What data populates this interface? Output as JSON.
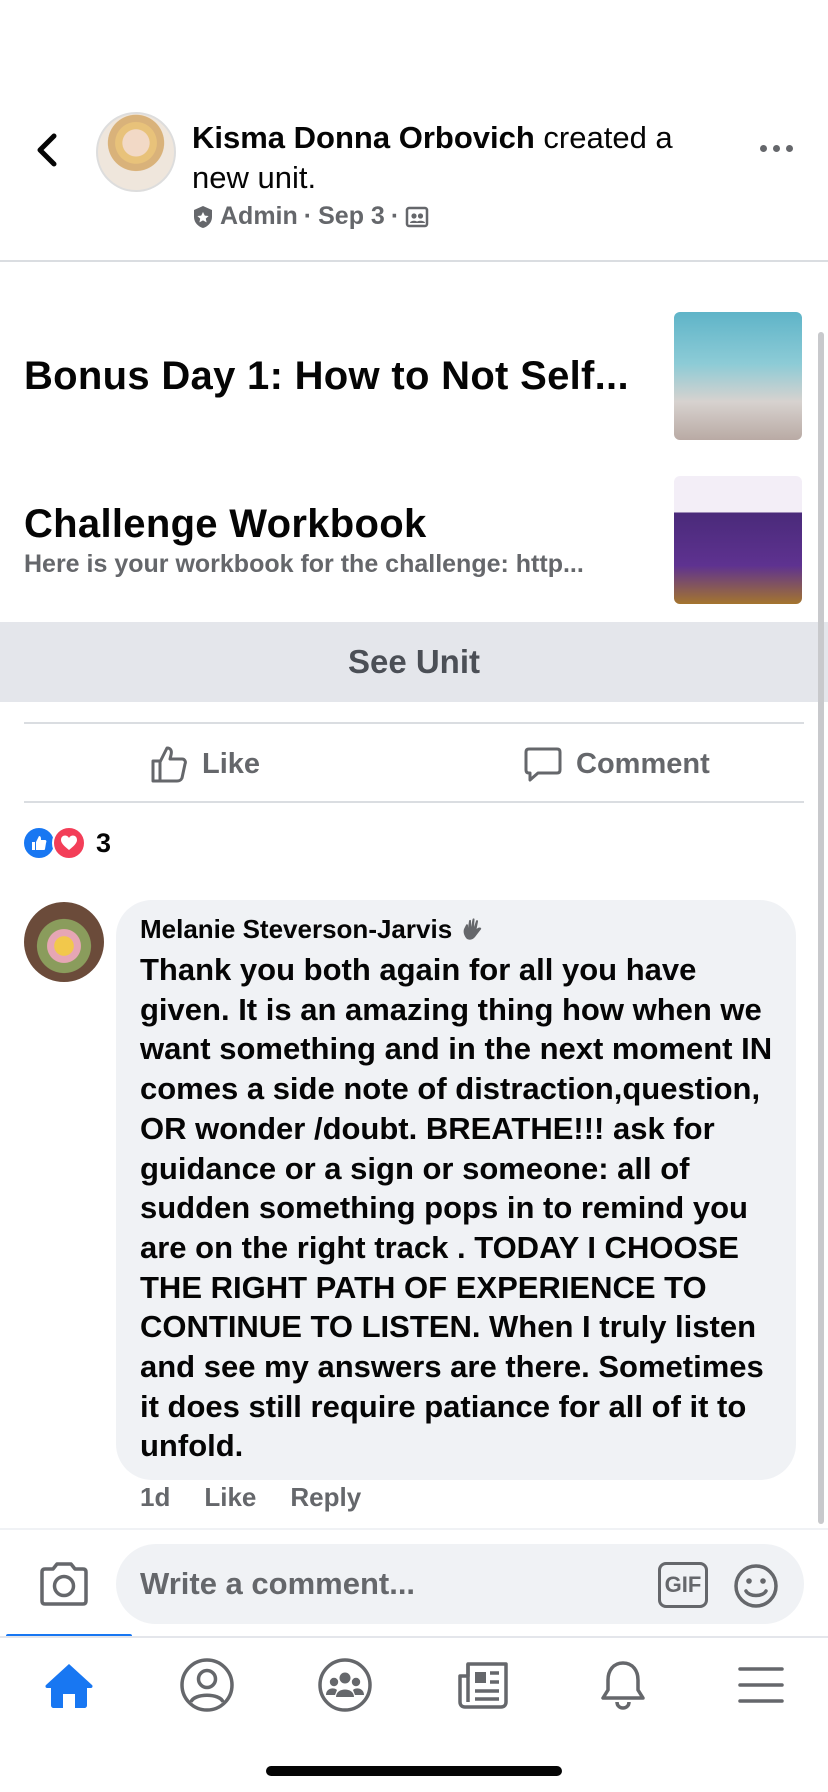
{
  "post": {
    "author": "Kisma Donna Orbovich",
    "action_text": "created a new unit.",
    "role": "Admin",
    "date": "Sep 3",
    "separator": "·"
  },
  "units": [
    {
      "title": "Bonus Day 1: How to Not Self...",
      "subtitle": ""
    },
    {
      "title": "Challenge Workbook",
      "subtitle": "Here is your workbook for the challenge: http..."
    }
  ],
  "see_unit_label": "See Unit",
  "actions": {
    "like_label": "Like",
    "comment_label": "Comment"
  },
  "reactions": {
    "count": "3"
  },
  "comment": {
    "author": "Melanie Steverson-Jarvis",
    "text": "Thank you both again for all you have given. It is an amazing thing how when we want something and in the next moment IN comes  a side note of distraction,question, OR  wonder /doubt. BREATHE!!! ask for guidance or a sign or someone:  all of sudden something pops in to remind you are on the right track . TODAY I CHOOSE THE RIGHT PATH  OF EXPERIENCE TO CONTINUE TO LISTEN. When I truly listen and see my answers are there. Sometimes it does still require patiance for all of it to unfold.",
    "age": "1d",
    "like_label": "Like",
    "reply_label": "Reply"
  },
  "composer": {
    "placeholder": "Write a comment...",
    "gif_label": "GIF"
  },
  "tabs": [
    "home-icon",
    "profile-icon",
    "groups-icon",
    "news-icon",
    "notifications-icon",
    "menu-icon"
  ],
  "colors": {
    "accent": "#1877f2",
    "love": "#f33e58",
    "muted": "#65676b",
    "bubble": "#f0f2f5"
  }
}
